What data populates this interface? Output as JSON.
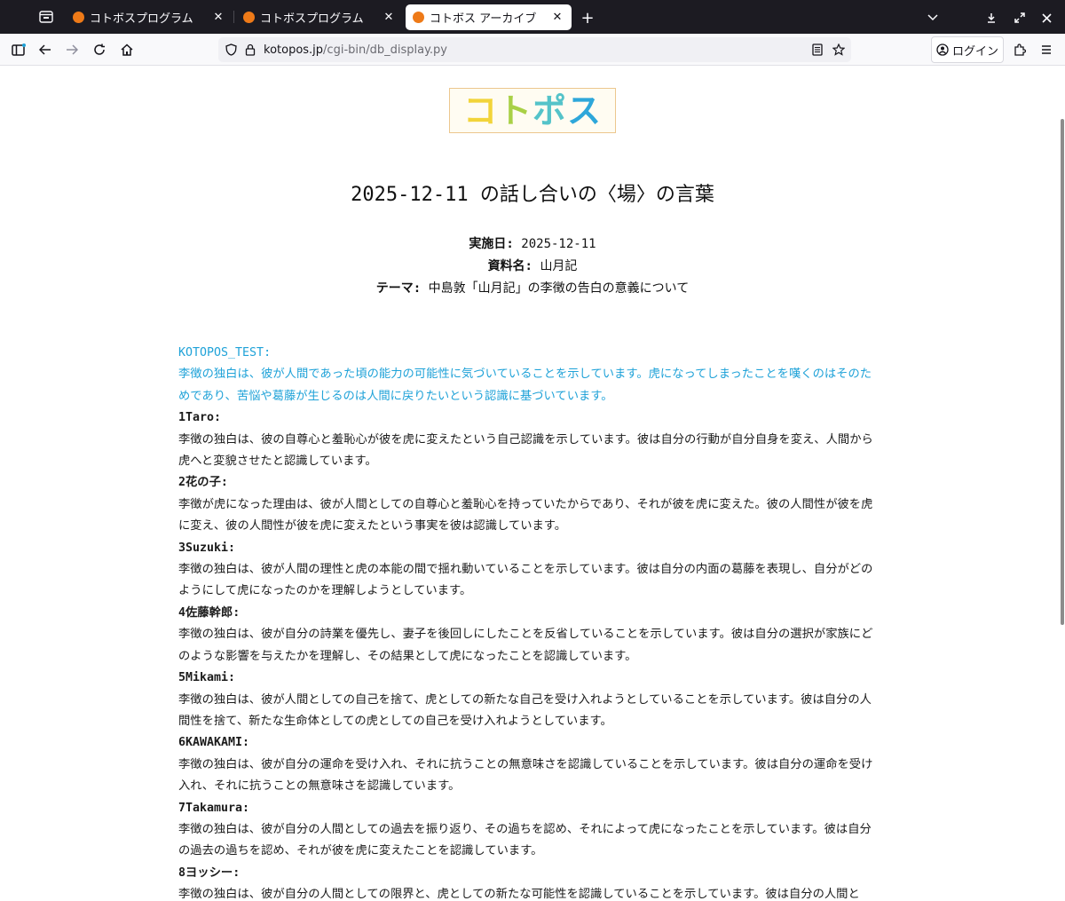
{
  "browser": {
    "tabs": [
      {
        "title": "コトボスプログラム",
        "favicon": "kotopos-favicon",
        "active": false
      },
      {
        "title": "コトボスプログラム",
        "favicon": "kotopos-favicon",
        "active": false
      },
      {
        "title": "コトボス アーカイブ",
        "favicon": "kotopos-favicon",
        "active": true
      }
    ],
    "url_domain": "kotopos.jp",
    "url_path": "/cgi-bin/db_display.py",
    "login_label": "ログイン"
  },
  "logo": {
    "text": [
      "コ",
      "ト",
      "ポ",
      "ス"
    ]
  },
  "page": {
    "title": "2025-12-11 の話し合いの〈場〉の言葉",
    "date_label": "実施日:",
    "date_value": "2025-12-11",
    "material_label": "資料名:",
    "material_value": "山月記",
    "theme_label": "テーマ:",
    "theme_value": "中島敦「山月記」の李徴の告白の意義について"
  },
  "comments": [
    {
      "author": "KOTOPOS_TEST:",
      "highlight": true,
      "text": "李徴の独白は、彼が人間であった頃の能力の可能性に気づいていることを示しています。虎になってしまったことを嘆くのはそのためであり、苦悩や葛藤が生じるのは人間に戻りたいという認識に基づいています。"
    },
    {
      "author": "1Taro:",
      "highlight": false,
      "text": "李徴の独白は、彼の自尊心と羞恥心が彼を虎に変えたという自己認識を示しています。彼は自分の行動が自分自身を変え、人間から虎へと変貌させたと認識しています。"
    },
    {
      "author": "2花の子:",
      "highlight": false,
      "text": "李徴が虎になった理由は、彼が人間としての自尊心と羞恥心を持っていたからであり、それが彼を虎に変えた。彼の人間性が彼を虎に変え、彼の人間性が彼を虎に変えたという事実を彼は認識しています。"
    },
    {
      "author": "3Suzuki:",
      "highlight": false,
      "text": "李徴の独白は、彼が人間の理性と虎の本能の間で揺れ動いていることを示しています。彼は自分の内面の葛藤を表現し、自分がどのようにして虎になったのかを理解しようとしています。"
    },
    {
      "author": "4佐藤幹郎:",
      "highlight": false,
      "text": "李徴の独白は、彼が自分の詩業を優先し、妻子を後回しにしたことを反省していることを示しています。彼は自分の選択が家族にどのような影響を与えたかを理解し、その結果として虎になったことを認識しています。"
    },
    {
      "author": "5Mikami:",
      "highlight": false,
      "text": "李徴の独白は、彼が人間としての自己を捨て、虎としての新たな自己を受け入れようとしていることを示しています。彼は自分の人間性を捨て、新たな生命体としての虎としての自己を受け入れようとしています。"
    },
    {
      "author": "6KAWAKAMI:",
      "highlight": false,
      "text": "李徴の独白は、彼が自分の運命を受け入れ、それに抗うことの無意味さを認識していることを示しています。彼は自分の運命を受け入れ、それに抗うことの無意味さを認識しています。"
    },
    {
      "author": "7Takamura:",
      "highlight": false,
      "text": "李徴の独白は、彼が自分の人間としての過去を振り返り、その過ちを認め、それによって虎になったことを示しています。彼は自分の過去の過ちを認め、それが彼を虎に変えたことを認識しています。"
    },
    {
      "author": "8ヨッシー:",
      "highlight": false,
      "text": "李徴の独白は、彼が自分の人間としての限界と、虎としての新たな可能性を認識していることを示しています。彼は自分の人間と"
    }
  ]
}
